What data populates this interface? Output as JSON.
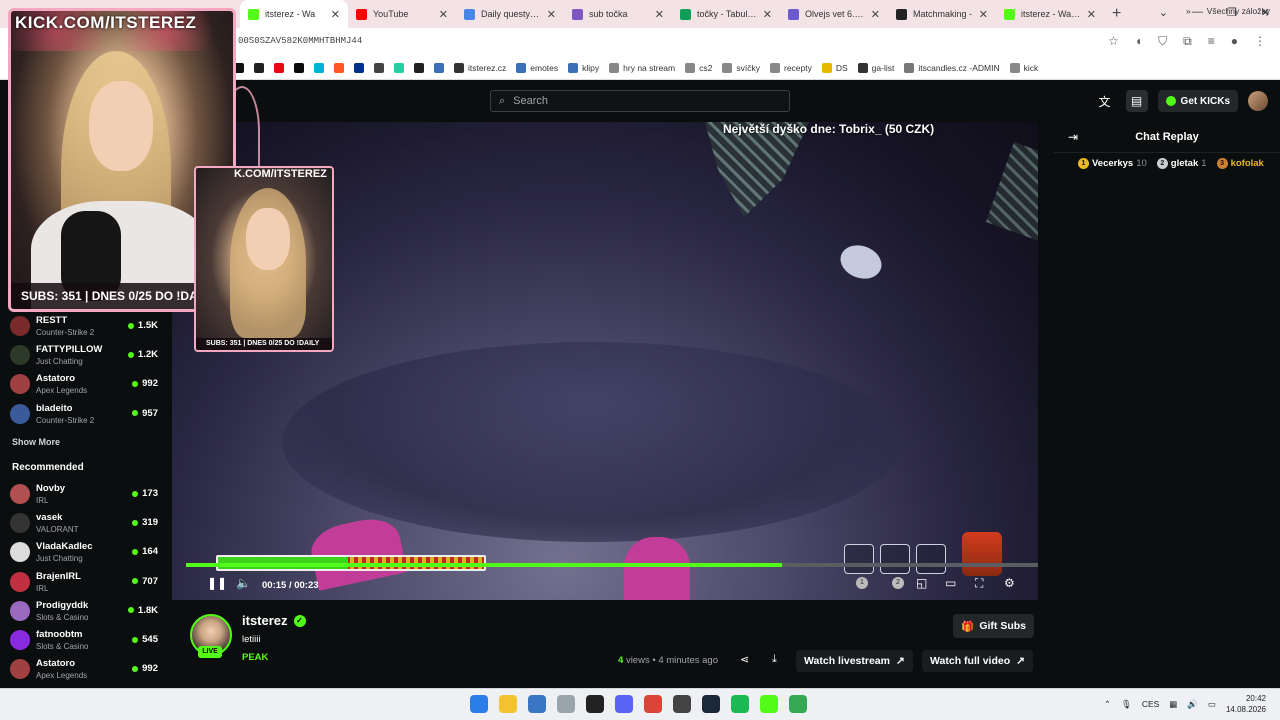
{
  "browser": {
    "tabs": [
      {
        "label": "itsterez - Wa",
        "color": "#53fc18",
        "active": true
      },
      {
        "label": "YouTube",
        "color": "#ff0000"
      },
      {
        "label": "Daily questy - Do",
        "color": "#4a86e8"
      },
      {
        "label": "sub točka",
        "color": "#7e57c2"
      },
      {
        "label": "točky - Tabulky G",
        "color": "#0f9d58"
      },
      {
        "label": "Olvejs vet 6.7 -",
        "color": "#6a5acd"
      },
      {
        "label": "Matchmaking -",
        "color": "#222222"
      },
      {
        "label": "itsterez - Watch",
        "color": "#53fc18"
      }
    ],
    "url": "00S0SZAV582K0MMHTBHMJ44",
    "bookmarks": [
      {
        "label": "",
        "color": "#111"
      },
      {
        "label": "",
        "color": "#222"
      },
      {
        "label": "",
        "color": "#e50914"
      },
      {
        "label": "",
        "color": "#0a0a0a"
      },
      {
        "label": "",
        "color": "#00b2d6"
      },
      {
        "label": "",
        "color": "#ff5722"
      },
      {
        "label": "",
        "color": "#003087"
      },
      {
        "label": "",
        "color": "#444"
      },
      {
        "label": "",
        "color": "#1fd1a0"
      },
      {
        "label": "",
        "color": "#222"
      },
      {
        "label": "",
        "color": "#3b6fb6"
      },
      {
        "label": "itsterez.cz",
        "color": "#333"
      },
      {
        "label": "emotes",
        "color": "#3b6fb6"
      },
      {
        "label": "klipy",
        "color": "#3b6fb6"
      },
      {
        "label": "hry na stream",
        "color": "#888"
      },
      {
        "label": "cs2",
        "color": "#888"
      },
      {
        "label": "svíčky",
        "color": "#888"
      },
      {
        "label": "recepty",
        "color": "#888"
      },
      {
        "label": "DS",
        "color": "#e6b800"
      },
      {
        "label": "ga-list",
        "color": "#333"
      },
      {
        "label": "itscandles.cz -ADMIN",
        "color": "#777"
      },
      {
        "label": "kick",
        "color": "#888"
      }
    ],
    "all_bookmarks": "Všechny záložky"
  },
  "header": {
    "search_placeholder": "Search",
    "get_kicks": "Get KICKs"
  },
  "overlay": {
    "watermark": "KICK.COM/ITSTEREZ",
    "subs": "SUBS: 351 | DNES 0/25 DO !DAILY",
    "watermark_small": "K.COM/ITSTEREZ",
    "subs_small": "SUBS: 351 | DNES 0/25 DO !DAILY"
  },
  "sidebar": {
    "following": [
      {
        "name": "RESTT",
        "category": "Counter-Strike 2",
        "viewers": "1.5K",
        "color": "#7a2a2a"
      },
      {
        "name": "FATTYPILLOW",
        "category": "Just Chatting",
        "viewers": "1.2K",
        "color": "#2d3a2a"
      },
      {
        "name": "Astatoro",
        "category": "Apex Legends",
        "viewers": "992",
        "color": "#a04040"
      },
      {
        "name": "bladeito",
        "category": "Counter-Strike 2",
        "viewers": "957",
        "color": "#3a5a9a"
      }
    ],
    "show_more": "Show More",
    "recommended_title": "Recommended",
    "recommended": [
      {
        "name": "Novby",
        "category": "IRL",
        "viewers": "173",
        "color": "#b05050"
      },
      {
        "name": "vasek",
        "category": "VALORANT",
        "viewers": "319",
        "color": "#333"
      },
      {
        "name": "VladaKadlec",
        "category": "Just Chatting",
        "viewers": "164",
        "color": "#dcdcdc"
      },
      {
        "name": "BrajenIRL",
        "category": "IRL",
        "viewers": "707",
        "color": "#c03040"
      },
      {
        "name": "Prodigyddk",
        "category": "Slots & Casino",
        "viewers": "1.8K",
        "color": "#9a6ac0"
      },
      {
        "name": "fatnoobtm",
        "category": "Slots & Casino",
        "viewers": "545",
        "color": "#8a2be2"
      },
      {
        "name": "Astatoro",
        "category": "Apex Legends",
        "viewers": "992",
        "color": "#a04040"
      }
    ]
  },
  "video": {
    "donation": "Největší dyško dne: Tobrix_ (50 CZK)",
    "current_time": "00:15",
    "duration": "00:23",
    "progress": 0.7,
    "health": 0.49,
    "slot_numbers": [
      "1",
      "2"
    ]
  },
  "chat": {
    "title": "Chat Replay",
    "gifters": [
      {
        "rank": "1",
        "name": "Vecerkys",
        "count": "10",
        "badge_color": "#e8b923"
      },
      {
        "rank": "2",
        "name": "gletak",
        "count": "1",
        "badge_color": "#c9ced3"
      },
      {
        "rank": "3",
        "name": "kofolak",
        "count": "",
        "badge_color": "#cd7f32",
        "name_color": "#e8b923"
      }
    ]
  },
  "channel": {
    "name": "itsterez",
    "title": "letiiii",
    "category": "PEAK",
    "live_badge": "LIVE",
    "gift_subs": "Gift Subs",
    "views_count": "4",
    "views_label": "views",
    "ago": "4 minutes ago",
    "watch_livestream": "Watch livestream",
    "watch_full_video": "Watch full video"
  },
  "taskbar": {
    "icons": [
      {
        "name": "windows-start-icon",
        "color": "#2b7de9"
      },
      {
        "name": "file-explorer-icon",
        "color": "#f4c430"
      },
      {
        "name": "ccleaner-icon",
        "color": "#3a76c4"
      },
      {
        "name": "excel-icon",
        "color": "#9aa4ad"
      },
      {
        "name": "obs-icon",
        "color": "#222"
      },
      {
        "name": "discord-icon",
        "color": "#5865f2"
      },
      {
        "name": "chrome-icon",
        "color": "#db4437"
      },
      {
        "name": "app-icon",
        "color": "#444"
      },
      {
        "name": "steam-icon",
        "color": "#1b2838"
      },
      {
        "name": "spotify-icon",
        "color": "#1db954"
      },
      {
        "name": "kick-icon",
        "color": "#53fc18"
      },
      {
        "name": "gdrive-icon",
        "color": "#34a853"
      }
    ],
    "lang": "CES",
    "time": "20:42",
    "date": "14.08.2026"
  }
}
